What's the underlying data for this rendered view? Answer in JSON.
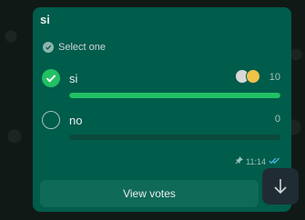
{
  "poll": {
    "title": "si",
    "instruction": "Select one",
    "options": [
      {
        "label": "si",
        "count": "10",
        "selected": true,
        "share": 1.0
      },
      {
        "label": "no",
        "count": "0",
        "selected": false,
        "share": 0.0
      }
    ],
    "time": "11:14",
    "view_votes_label": "View votes"
  },
  "icons": {
    "instruction_icon": "select-one-check-icon",
    "pin_icon": "pin-icon",
    "read_receipt_icon": "double-check-icon",
    "scroll_icon": "arrow-down-icon"
  },
  "colors": {
    "bubble": "#005c4b",
    "accent": "#21c063",
    "read_ticks": "#53bdeb"
  }
}
